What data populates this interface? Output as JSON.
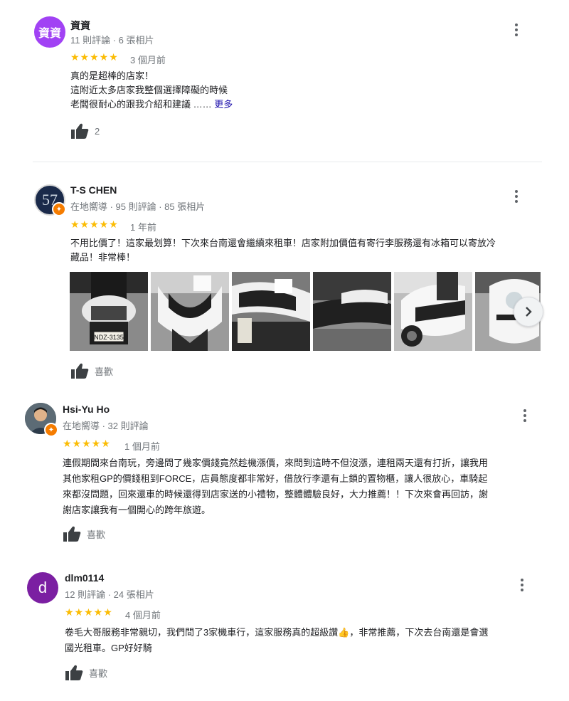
{
  "reviews": [
    {
      "avatar_text": "資資",
      "avatar_color": "#a142f4",
      "name": "資資",
      "meta": "11 則評論 · 6 張相片",
      "stars": "★★★★★",
      "rating": 5,
      "ago": "3 個月前",
      "text_lines": [
        "真的是超棒的店家！",
        "這附近太多店家我整個選擇障礙的時候",
        "老闆很耐心的跟我介紹和建議 ……"
      ],
      "more": "更多",
      "likes": "2"
    },
    {
      "avatar_text": "57",
      "name": "T-S CHEN",
      "meta": "在地嚮導 · 95 則評論 · 85 張相片",
      "stars": "★★★★★",
      "rating": 5,
      "ago": "1 年前",
      "text_lines": [
        "不用比價了！這家最划算！下次來台南還會繼續來租車！店家附加價值有寄行李服務還有冰箱可以寄放冷",
        "藏品！非常棒！"
      ],
      "plate": "NDZ-3135",
      "likes": "喜歡"
    },
    {
      "name": "Hsi-Yu Ho",
      "meta": "在地嚮導 · 32 則評論",
      "stars": "★★★★★",
      "rating": 5,
      "ago": "1 個月前",
      "text_lines": [
        "連假期間來台南玩，旁邊問了幾家價錢竟然趁機漲價，來問到這時不但沒漲，連租兩天還有打折，讓我用",
        "其他家租GP的價錢租到FORCE，店員態度都非常好，借放行李還有上鎖的置物櫃，讓人很放心，車騎起",
        "來都沒問題，回來還車的時候還得到店家送的小禮物，整體體驗良好，大力推薦！！下次來會再回訪，謝",
        "謝店家讓我有一個開心的跨年旅遊。"
      ],
      "likes": "喜歡"
    },
    {
      "avatar_text": "d",
      "avatar_color": "#7b1fa2",
      "name": "dlm0114",
      "meta": "12 則評論 · 24 張相片",
      "stars": "★★★★★",
      "rating": 5,
      "ago": "4 個月前",
      "text_lines": [
        "卷毛大哥服務非常親切，我們問了3家機車行，這家服務真的超級讚👍，非常推薦，下次去台南還是會選",
        "國光租車。GP好好騎"
      ],
      "likes": "喜歡"
    }
  ]
}
